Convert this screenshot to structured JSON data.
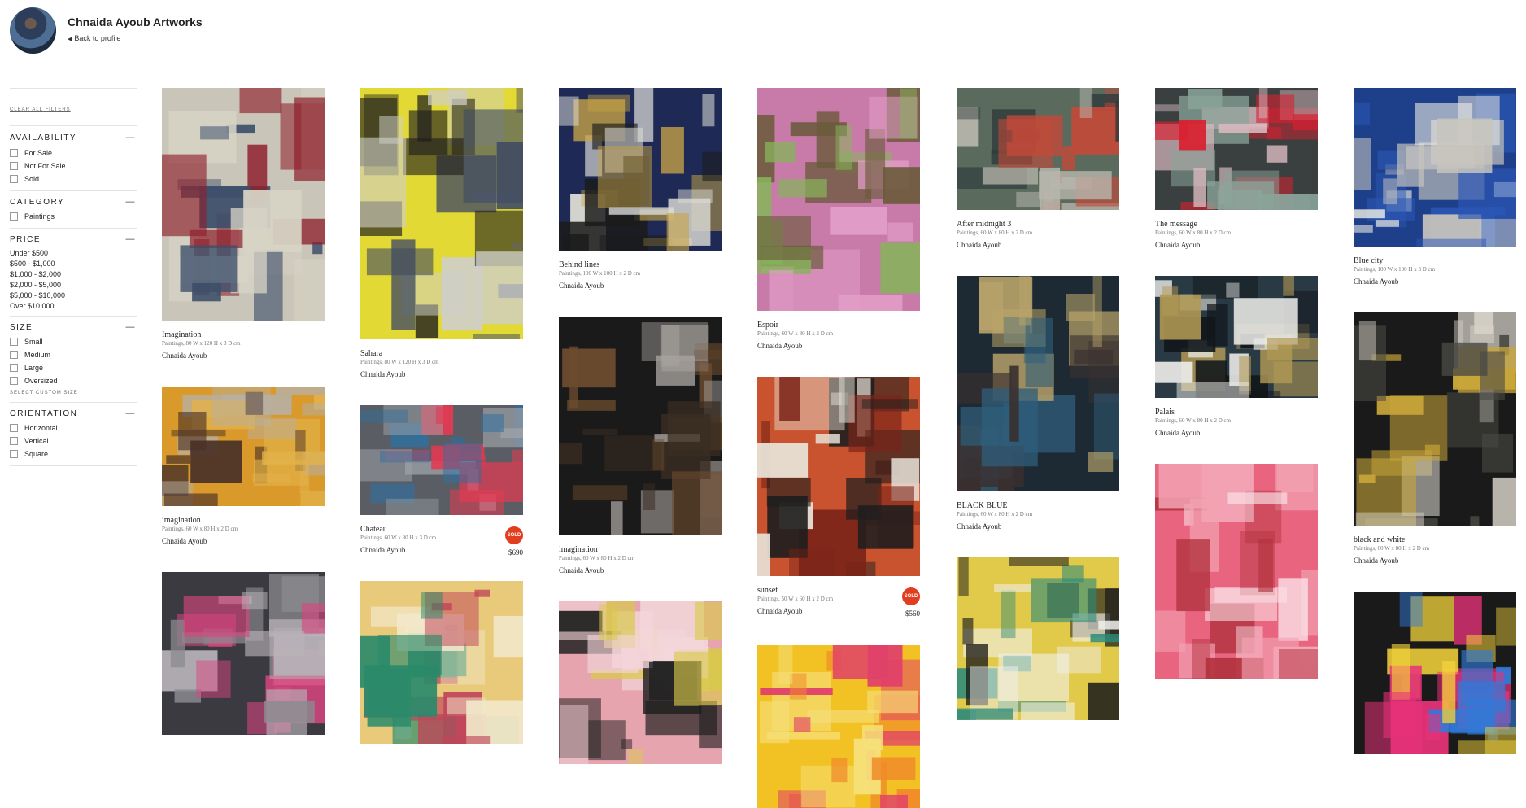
{
  "header": {
    "title": "Chnaida Ayoub Artworks",
    "back_link": "Back to profile"
  },
  "filters": {
    "clear_all": "Clear all filters",
    "availability": {
      "title": "AVAILABILITY",
      "options": [
        "For Sale",
        "Not For Sale",
        "Sold"
      ]
    },
    "category": {
      "title": "CATEGORY",
      "options": [
        "Paintings"
      ]
    },
    "price": {
      "title": "PRICE",
      "options": [
        "Under $500",
        "$500 - $1,000",
        "$1,000 - $2,000",
        "$2,000 - $5,000",
        "$5,000 - $10,000",
        "Over $10,000"
      ]
    },
    "size": {
      "title": "SIZE",
      "options": [
        "Small",
        "Medium",
        "Large",
        "Oversized"
      ],
      "custom_link": "Select custom size"
    },
    "orientation": {
      "title": "ORIENTATION",
      "options": [
        "Horizontal",
        "Vertical",
        "Square"
      ]
    }
  },
  "artworks": [
    {
      "title": "Imagination",
      "dims": "Paintings, 80 W x 120 H x 3 D cm",
      "artist": "Chnaida Ayoub",
      "sold": false,
      "price": "",
      "colors": [
        "#c9c5b8",
        "#8e1f2c",
        "#3d4f6b",
        "#d7d3c6"
      ]
    },
    {
      "title": "imagination",
      "dims": "Paintings, 60 W x 80 H x 2 D cm",
      "artist": "Chnaida Ayoub",
      "sold": false,
      "price": "",
      "colors": [
        "#d99a2b",
        "#4a3128",
        "#b6b0a6",
        "#e2b24a"
      ]
    },
    {
      "title": "",
      "dims": "",
      "artist": "",
      "sold": false,
      "price": "",
      "colors": [
        "#3a3a40",
        "#d9457f",
        "#b9b3b8",
        "#8a8a8f"
      ]
    },
    {
      "title": "Sahara",
      "dims": "Paintings, 80 W x 120 H x 3 D cm",
      "artist": "Chnaida Ayoub",
      "sold": false,
      "price": "",
      "colors": [
        "#e3d935",
        "#1e1e1e",
        "#cfcfc8",
        "#3f4a63"
      ]
    },
    {
      "title": "Chateau",
      "dims": "Paintings, 60 W x 80 H x 3 D cm",
      "artist": "Chnaida Ayoub",
      "sold": true,
      "price": "$690",
      "colors": [
        "#5a5e64",
        "#e23a52",
        "#2f6fa0",
        "#9aa0a6"
      ]
    },
    {
      "title": "",
      "dims": "",
      "artist": "",
      "sold": false,
      "price": "",
      "colors": [
        "#e9c97a",
        "#c0455a",
        "#2a8a6a",
        "#f1e7c9"
      ]
    },
    {
      "title": "Behind lines",
      "dims": "Paintings, 100 W x 100 H x 2 D cm",
      "artist": "Chnaida Ayoub",
      "sold": false,
      "price": "",
      "colors": [
        "#1e2a55",
        "#c8a448",
        "#dcdcd6",
        "#1b1b1b"
      ]
    },
    {
      "title": "imagination",
      "dims": "Paintings, 60 W x 80 H x 2 D cm",
      "artist": "Chnaida Ayoub",
      "sold": false,
      "price": "",
      "colors": [
        "#1a1a1a",
        "#6d4c2e",
        "#a8a4a0",
        "#3a2c22"
      ]
    },
    {
      "title": "",
      "dims": "",
      "artist": "",
      "sold": false,
      "price": "",
      "colors": [
        "#e6a4ae",
        "#1f1f1f",
        "#d9c94a",
        "#f3d6da"
      ]
    },
    {
      "title": "Espoir",
      "dims": "Paintings, 60 W x 80 H x 2 D cm",
      "artist": "Chnaida Ayoub",
      "sold": false,
      "price": "",
      "colors": [
        "#c87aa8",
        "#6a5a3a",
        "#86b45a",
        "#e3a0c9"
      ]
    },
    {
      "title": "sunset",
      "dims": "Paintings, 50 W x 60 H x 2 D cm",
      "artist": "Chnaida Ayoub",
      "sold": true,
      "price": "$560",
      "colors": [
        "#c9532e",
        "#1e1e1e",
        "#e8e2d8",
        "#7a2418"
      ]
    },
    {
      "title": "",
      "dims": "",
      "artist": "",
      "sold": false,
      "price": "",
      "colors": [
        "#f2c224",
        "#e0406a",
        "#f6e07a",
        "#f08a2a"
      ]
    },
    {
      "title": "After midnight 3",
      "dims": "Paintings, 60 W x 80 H x 2 D cm",
      "artist": "Chnaida Ayoub",
      "sold": false,
      "price": "",
      "colors": [
        "#5a6b5e",
        "#c24a3a",
        "#b8b6ac",
        "#2d3a3a"
      ]
    },
    {
      "title": "BLACK BLUE",
      "dims": "Paintings, 60 W x 80 H x 2 D cm",
      "artist": "Chnaida Ayoub",
      "sold": false,
      "price": "",
      "colors": [
        "#1d2a33",
        "#2f5e7a",
        "#b9a46a",
        "#3a3030"
      ]
    },
    {
      "title": "",
      "dims": "",
      "artist": "",
      "sold": false,
      "price": "",
      "colors": [
        "#e1c94a",
        "#2a8a7a",
        "#1a1a1a",
        "#f1f1ee"
      ]
    },
    {
      "title": "The message",
      "dims": "Paintings, 60 W x 80 H x 2 D cm",
      "artist": "Chnaida Ayoub",
      "sold": false,
      "price": "",
      "colors": [
        "#3a4040",
        "#d92030",
        "#d9b9bf",
        "#8aa49a"
      ]
    },
    {
      "title": "Palais",
      "dims": "Paintings, 60 W x 80 H x 2 D cm",
      "artist": "Chnaida Ayoub",
      "sold": false,
      "price": "",
      "colors": [
        "#2a3a45",
        "#b39a55",
        "#e9e9e6",
        "#11161a"
      ]
    },
    {
      "title": "",
      "dims": "",
      "artist": "",
      "sold": false,
      "price": "",
      "colors": [
        "#e9647f",
        "#f2a2b2",
        "#b2323e",
        "#fbe3e8"
      ]
    },
    {
      "title": "Blue city",
      "dims": "Paintings, 100 W x 100 H x 3 D cm",
      "artist": "Chnaida Ayoub",
      "sold": false,
      "price": "",
      "colors": [
        "#1e3f8a",
        "#e9e9e3",
        "#2b57b5",
        "#c7c4bc"
      ]
    },
    {
      "title": "black and white",
      "dims": "Paintings, 60 W x 80 H x 2 D cm",
      "artist": "Chnaida Ayoub",
      "sold": false,
      "price": "",
      "colors": [
        "#1a1a1a",
        "#c9a63a",
        "#d6d2c8",
        "#4a4a44"
      ]
    },
    {
      "title": "",
      "dims": "",
      "artist": "",
      "sold": false,
      "price": "",
      "colors": [
        "#1a1a1a",
        "#e9327a",
        "#f2d23a",
        "#2f7ad9"
      ]
    }
  ]
}
